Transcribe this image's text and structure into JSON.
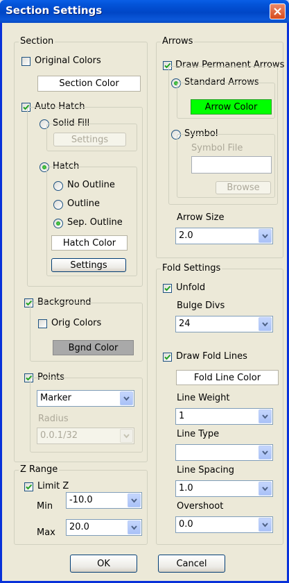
{
  "window": {
    "title": "Section Settings"
  },
  "section": {
    "legend": "Section",
    "original_colors": "Original Colors",
    "section_color_btn": "Section Color",
    "auto_hatch": "Auto Hatch",
    "solid_fill": "Solid Fill",
    "solid_settings": "Settings",
    "hatch": "Hatch",
    "no_outline": "No Outline",
    "outline": "Outline",
    "sep_outline": "Sep. Outline",
    "hatch_color": "Hatch Color",
    "hatch_settings": "Settings",
    "background": "Background",
    "orig_colors": "Orig Colors",
    "bgnd_color": "Bgnd Color",
    "points": "Points",
    "marker_value": "Marker",
    "radius_label": "Radius",
    "radius_value": "0.0.1/32"
  },
  "zrange": {
    "legend": "Z Range",
    "limit_z": "Limit Z",
    "min_label": "Min",
    "min_value": "-10.0",
    "max_label": "Max",
    "max_value": "20.0"
  },
  "arrows": {
    "legend": "Arrows",
    "draw_permanent": "Draw Permanent Arrows",
    "standard": "Standard Arrows",
    "arrow_color": "Arrow Color",
    "arrow_color_hex": "#00ff00",
    "symbol": "Symbol",
    "symbol_file_label": "Symbol File",
    "symbol_file_value": "",
    "browse": "Browse",
    "arrow_size_label": "Arrow Size",
    "arrow_size_value": "2.0"
  },
  "fold": {
    "legend": "Fold Settings",
    "unfold": "Unfold",
    "bulge_label": "Bulge Divs",
    "bulge_value": "24",
    "draw_fold_lines": "Draw Fold Lines",
    "fold_line_color": "Fold Line Color",
    "line_weight_label": "Line Weight",
    "line_weight_value": "1",
    "line_type_label": "Line Type",
    "line_type_value": "",
    "line_spacing_label": "Line Spacing",
    "line_spacing_value": "1.0",
    "overshoot_label": "Overshoot",
    "overshoot_value": "0.0"
  },
  "footer": {
    "ok": "OK",
    "cancel": "Cancel"
  },
  "state": {
    "original_colors": false,
    "auto_hatch": true,
    "solid_fill": false,
    "hatch": true,
    "no_outline": false,
    "outline": false,
    "sep_outline": true,
    "background": true,
    "orig_colors": false,
    "points": true,
    "limit_z": true,
    "draw_permanent": true,
    "standard_arrows": true,
    "symbol": false,
    "unfold": true,
    "draw_fold_lines": true
  }
}
